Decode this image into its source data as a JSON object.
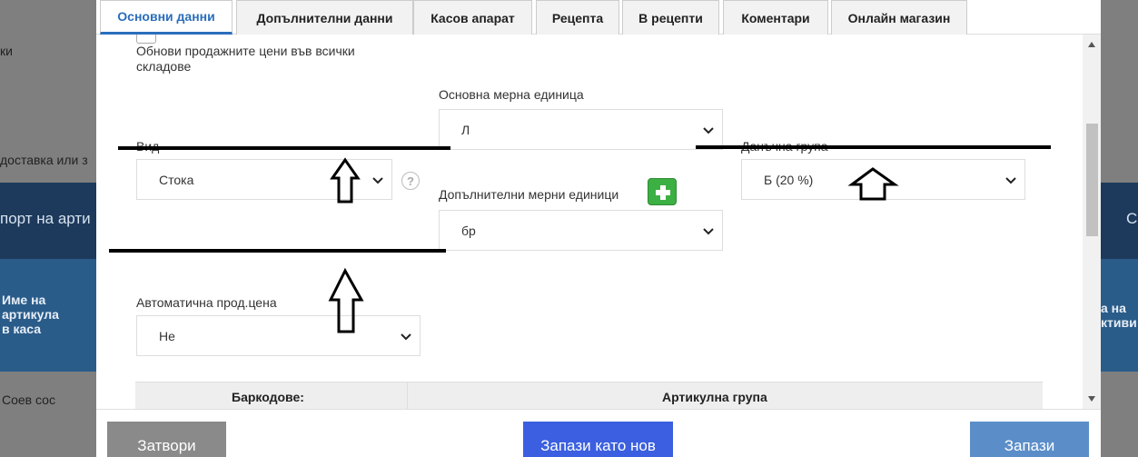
{
  "background": {
    "left_snippet_1": "ки",
    "left_snippet_2": "доставка или з",
    "band_left": "порт на арти",
    "band_right": "С",
    "col_header": [
      "Име на",
      "артикула",
      "в каса"
    ],
    "col_header_right": [
      "а на",
      "ктиви"
    ],
    "row_item": "Соев сос"
  },
  "tabs": [
    {
      "label": "Основни данни"
    },
    {
      "label": "Допълнителни данни"
    },
    {
      "label": "Касов апарат"
    },
    {
      "label": "Рецепта"
    },
    {
      "label": "В рецепти"
    },
    {
      "label": "Коментари"
    },
    {
      "label": "Онлайн магазин"
    }
  ],
  "form": {
    "update_prices_label": "Обнови продажните цени във всички складове",
    "update_prices_line1": "Обнови продажните цени във всички",
    "update_prices_line2": "складове",
    "main_unit": {
      "label": "Основна мерна единица",
      "value": "Л"
    },
    "type": {
      "label": "Вид",
      "value": "Стока",
      "help": "?"
    },
    "tax_group": {
      "label": "Данъчна група",
      "value": "Б (20 %)"
    },
    "extra_units": {
      "label": "Допълнителни мерни единици",
      "value": "бр"
    },
    "auto_price": {
      "label": "Автоматична прод.цена",
      "value": "Не"
    },
    "table_headers": {
      "barcodes": "Баркодове:",
      "article_group": "Артикулна група"
    }
  },
  "footer": {
    "close": "Затвори",
    "save_as_new": "Запази като нов",
    "save": "Запази"
  },
  "colors": {
    "accent": "#2a6ebb",
    "close_button": "#8a8a8a",
    "save_as_new_button": "#3b5fe0",
    "save_button": "#5b8ec9",
    "plus_button": "#3cb043"
  }
}
